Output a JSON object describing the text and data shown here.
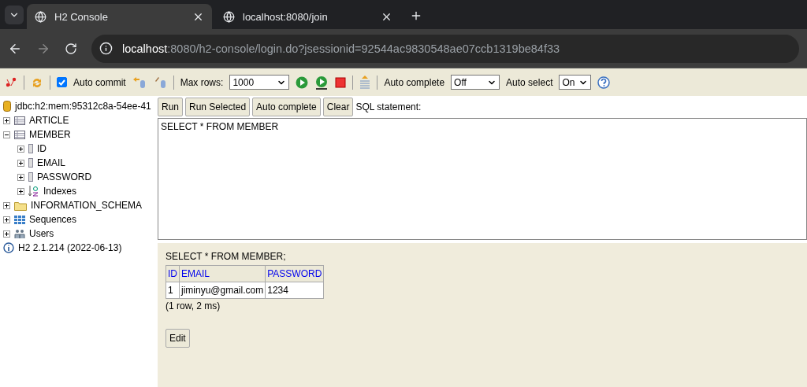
{
  "browser": {
    "tabs": [
      {
        "title": "H2 Console",
        "selected": true
      },
      {
        "title": "localhost:8080/join",
        "selected": false
      }
    ],
    "url": {
      "host": "localhost",
      "path": ":8080/h2-console/login.do?jsessionid=92544ac9830548ae07ccb1319be84f33"
    }
  },
  "toolbar": {
    "auto_commit": {
      "label": "Auto commit",
      "checked": true
    },
    "max_rows": {
      "label": "Max rows:",
      "value": "1000"
    },
    "auto_complete": {
      "label": "Auto complete",
      "value": "Off"
    },
    "auto_select": {
      "label": "Auto select",
      "value": "On"
    }
  },
  "sidebar": {
    "connection": "jdbc:h2:mem:95312c8a-54ee-41",
    "tree": [
      {
        "label": "ARTICLE",
        "kind": "table",
        "expanded": false
      },
      {
        "label": "MEMBER",
        "kind": "table",
        "expanded": true,
        "children": [
          {
            "label": "ID",
            "kind": "column",
            "expanded": false
          },
          {
            "label": "EMAIL",
            "kind": "column",
            "expanded": false
          },
          {
            "label": "PASSWORD",
            "kind": "column",
            "expanded": false
          },
          {
            "label": "Indexes",
            "kind": "index",
            "expanded": false
          }
        ]
      },
      {
        "label": "INFORMATION_SCHEMA",
        "kind": "folder",
        "expanded": false
      },
      {
        "label": "Sequences",
        "kind": "sequence",
        "expanded": false
      },
      {
        "label": "Users",
        "kind": "users",
        "expanded": false
      }
    ],
    "version": "H2 2.1.214 (2022-06-13)"
  },
  "query": {
    "buttons": [
      "Run",
      "Run Selected",
      "Auto complete",
      "Clear"
    ],
    "label": "SQL statement:",
    "sql": "SELECT * FROM MEMBER"
  },
  "result": {
    "statement": "SELECT * FROM MEMBER;",
    "columns": [
      "ID",
      "EMAIL",
      "PASSWORD"
    ],
    "rows": [
      [
        "1",
        "jiminyu@gmail.com",
        "1234"
      ]
    ],
    "summary": "(1 row, 2 ms)",
    "edit_button": "Edit"
  }
}
